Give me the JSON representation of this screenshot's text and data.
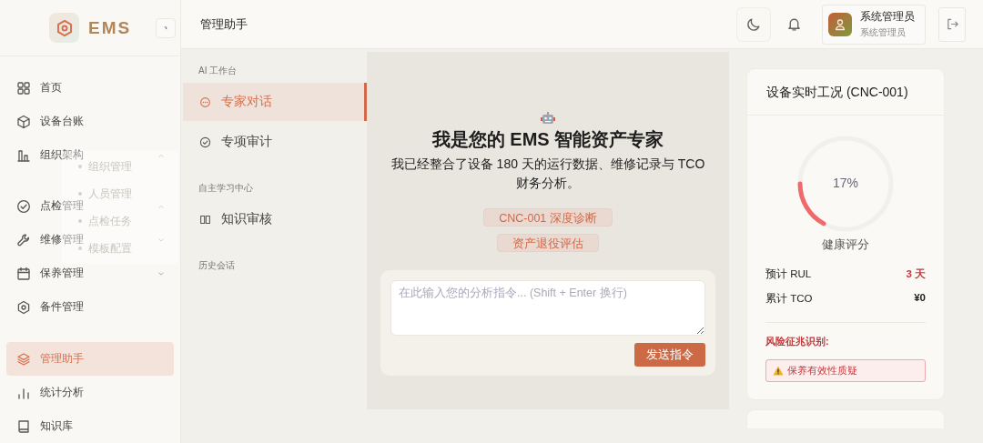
{
  "sidebar": {
    "logo": "EMS",
    "groups": [
      {
        "items": [
          {
            "label": "首页",
            "selected": false
          },
          {
            "label": "设备台账",
            "selected": false
          },
          {
            "label": "组织架构",
            "selected": false,
            "expanded": true,
            "children": [
              {
                "label": "组织管理"
              },
              {
                "label": "人员管理"
              }
            ]
          },
          {
            "label": "点检管理",
            "selected": false,
            "expanded": true,
            "children": [
              {
                "label": "点检任务"
              },
              {
                "label": "模板配置"
              }
            ]
          },
          {
            "label": "维修管理",
            "selected": false,
            "expanded": false
          },
          {
            "label": "保养管理",
            "selected": false,
            "expanded": false
          },
          {
            "label": "备件管理",
            "selected": false
          }
        ]
      },
      {
        "items": [
          {
            "label": "管理助手",
            "selected": true
          },
          {
            "label": "统计分析",
            "selected": false
          },
          {
            "label": "知识库",
            "selected": false
          }
        ]
      }
    ]
  },
  "header": {
    "title": "管理助手",
    "user": {
      "name": "系统管理员",
      "role": "系统管理员"
    }
  },
  "ai_nav": {
    "sections": [
      {
        "title": "AI 工作台",
        "items": [
          {
            "label": "专家对话",
            "selected": true
          },
          {
            "label": "专项审计",
            "selected": false
          }
        ]
      },
      {
        "title": "自主学习中心",
        "items": [
          {
            "label": "知识审核",
            "selected": false
          }
        ]
      },
      {
        "title": "历史会话"
      }
    ]
  },
  "chat": {
    "title": "我是您的 EMS 智能资产专家",
    "intro": "我已经整合了设备 180 天的运行数据、维修记录与 TCO 财务分析。",
    "suggestions": [
      "CNC-001 深度诊断",
      "资产退役评估"
    ],
    "input": {
      "placeholder": "在此输入您的分析指令... (Shift + Enter 换行)"
    },
    "send": "发送指令"
  },
  "status": {
    "title": "设备实时工况 (CNC-001)",
    "health": {
      "level": 0.17,
      "reading": "17%",
      "label": "健康评分"
    },
    "metrics": [
      {
        "label": "预计 RUL",
        "value": "3 天",
        "alert": true
      },
      {
        "label": "累计 TCO",
        "value": "¥0",
        "alert": false
      }
    ],
    "risk_title": "风险征兆识别:",
    "risks": [
      "保养有效性质疑"
    ]
  }
}
